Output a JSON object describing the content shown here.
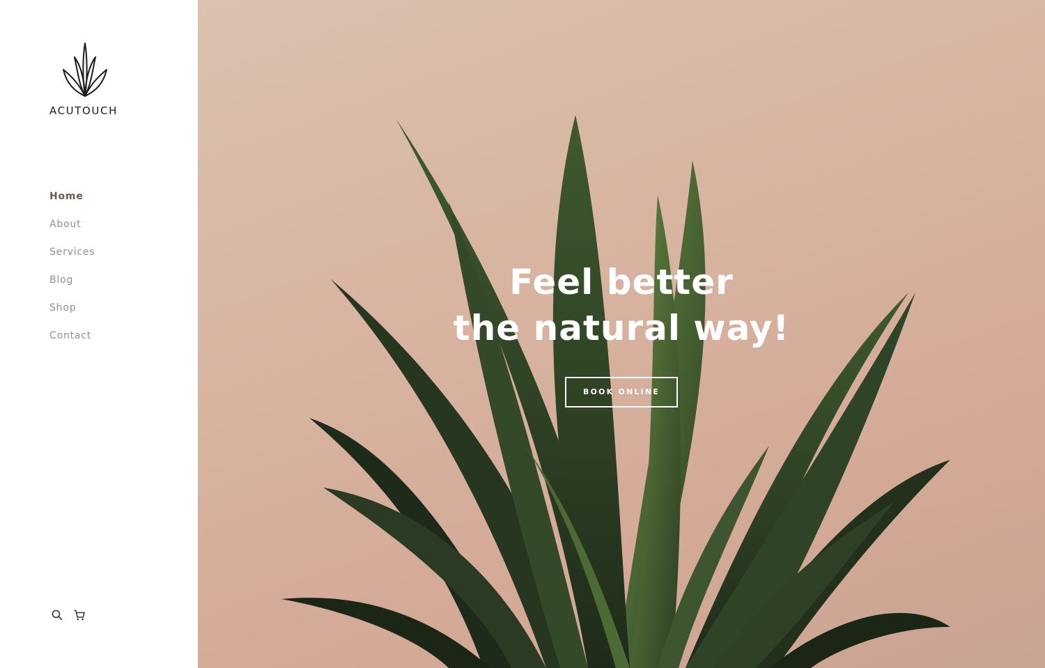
{
  "brand": {
    "name": "ACUTOUCH",
    "logo_icon": "agave-leaves-icon"
  },
  "nav": {
    "items": [
      {
        "label": "Home",
        "active": true
      },
      {
        "label": "About",
        "active": false
      },
      {
        "label": "Services",
        "active": false
      },
      {
        "label": "Blog",
        "active": false
      },
      {
        "label": "Shop",
        "active": false
      },
      {
        "label": "Contact",
        "active": false
      }
    ]
  },
  "utility": {
    "search_icon": "search-icon",
    "cart_icon": "cart-icon"
  },
  "hero": {
    "headline_line1": "Feel better",
    "headline_line2": "the natural way!",
    "cta_label": "BOOK ONLINE"
  },
  "colors": {
    "nav_active": "#6e5a4a",
    "nav_default": "#8f8f8f",
    "hero_background": "#d8b4a1",
    "plant_dark": "#2a3a24",
    "plant_light": "#5f7f40"
  }
}
